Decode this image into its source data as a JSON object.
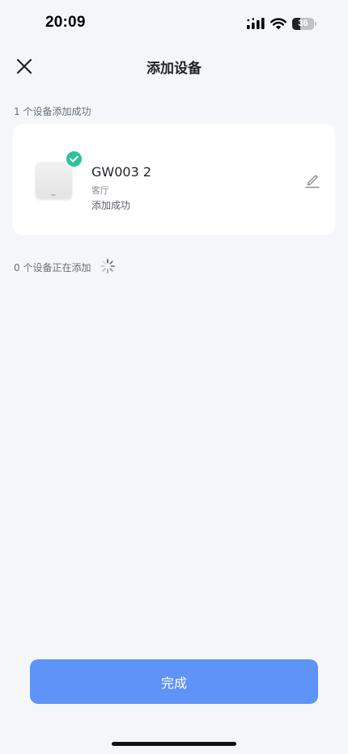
{
  "status_bar": {
    "time": "20:09",
    "battery_level": "36",
    "icons": [
      "signal-icon",
      "wifi-icon",
      "battery-icon"
    ]
  },
  "header": {
    "title": "添加设备",
    "close_icon": "close-icon"
  },
  "sections": {
    "success_label": "1 个设备添加成功",
    "adding_label": "0 个设备正在添加"
  },
  "devices": [
    {
      "name": "GW003 2",
      "room": "客厅",
      "status": "添加成功",
      "badge_icon": "check-icon",
      "edit_icon": "edit-icon"
    }
  ],
  "footer": {
    "done_label": "完成"
  },
  "colors": {
    "background": "#f4f6fa",
    "primary_button": "#5e93f7",
    "success_badge": "#2cc39a",
    "card": "#ffffff"
  }
}
